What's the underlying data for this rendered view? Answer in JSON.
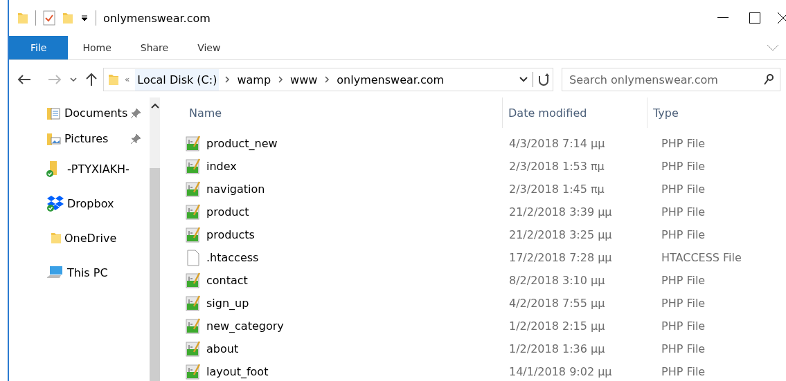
{
  "window": {
    "title": "onlymenswear.com"
  },
  "ribbon_tabs": [
    {
      "label": "File",
      "selected": true
    },
    {
      "label": "Home",
      "selected": false
    },
    {
      "label": "Share",
      "selected": false
    },
    {
      "label": "View",
      "selected": false
    }
  ],
  "address_bar": {
    "overflow": "«",
    "crumbs": [
      "Local Disk (C:)",
      "wamp",
      "www",
      "onlymenswear.com"
    ]
  },
  "search": {
    "placeholder": "Search onlymenswear.com"
  },
  "sidebar": {
    "items": [
      {
        "label": "Documents",
        "kind": "documents",
        "pinned": true
      },
      {
        "label": "Pictures",
        "kind": "pictures",
        "pinned": true
      },
      {
        "label": "-PTYXIAKH-",
        "kind": "synced-folder",
        "pinned": false
      },
      {
        "label": "Dropbox",
        "kind": "dropbox",
        "pinned": false
      },
      {
        "label": "OneDrive",
        "kind": "folder",
        "pinned": false
      },
      {
        "label": "This PC",
        "kind": "computer",
        "pinned": false
      }
    ]
  },
  "table": {
    "columns": [
      "Name",
      "Date modified",
      "Type"
    ],
    "rows": [
      {
        "name": "product_new",
        "date": "4/3/2018 7:14 μμ",
        "type": "PHP File",
        "kind": "php"
      },
      {
        "name": "index",
        "date": "2/3/2018 1:53 πμ",
        "type": "PHP File",
        "kind": "php"
      },
      {
        "name": "navigation",
        "date": "2/3/2018 1:45 πμ",
        "type": "PHP File",
        "kind": "php"
      },
      {
        "name": "product",
        "date": "21/2/2018 3:39 μμ",
        "type": "PHP File",
        "kind": "php"
      },
      {
        "name": "products",
        "date": "21/2/2018 3:25 μμ",
        "type": "PHP File",
        "kind": "php"
      },
      {
        "name": ".htaccess",
        "date": "17/2/2018 7:28 μμ",
        "type": "HTACCESS File",
        "kind": "blank"
      },
      {
        "name": "contact",
        "date": "8/2/2018 3:10 μμ",
        "type": "PHP File",
        "kind": "php"
      },
      {
        "name": "sign_up",
        "date": "4/2/2018 7:55 μμ",
        "type": "PHP File",
        "kind": "php"
      },
      {
        "name": "new_category",
        "date": "1/2/2018 2:15 μμ",
        "type": "PHP File",
        "kind": "php"
      },
      {
        "name": "about",
        "date": "1/2/2018 1:36 μμ",
        "type": "PHP File",
        "kind": "php"
      },
      {
        "name": "layout_foot",
        "date": "14/1/2018 9:02 μμ",
        "type": "PHP File",
        "kind": "php"
      }
    ]
  }
}
